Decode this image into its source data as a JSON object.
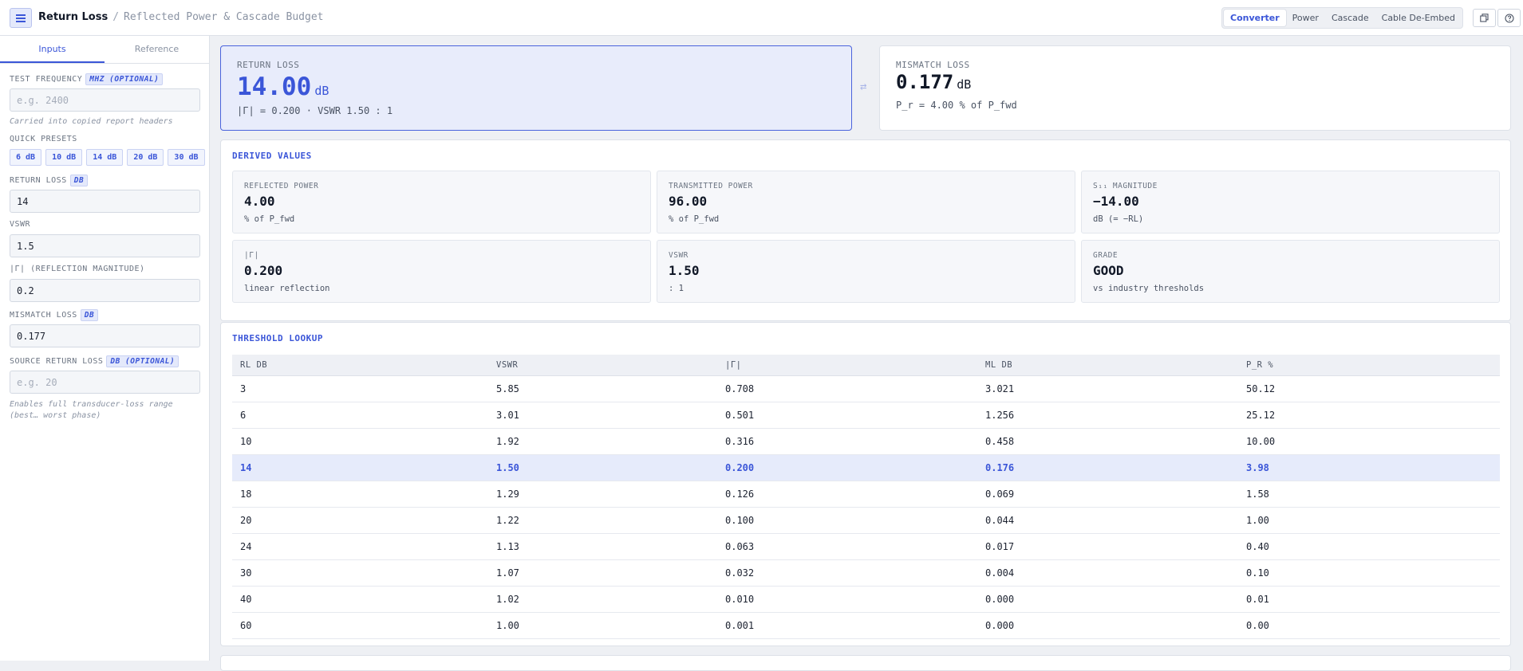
{
  "header": {
    "title": "Return Loss",
    "separator": "/",
    "subtitle": "Reflected Power & Cascade Budget",
    "modes": [
      "Converter",
      "Power",
      "Cascade",
      "Cable De-Embed"
    ],
    "active_mode": "Converter"
  },
  "sidebar": {
    "tabs": [
      "Inputs",
      "Reference"
    ],
    "active_tab": "Inputs",
    "test_frequency": {
      "label": "TEST FREQUENCY",
      "unit": "MHZ (OPTIONAL)",
      "value": "",
      "placeholder": "e.g. 2400",
      "hint": "Carried into copied report headers"
    },
    "quick_presets": {
      "label": "QUICK PRESETS",
      "items": [
        "6 dB",
        "10 dB",
        "14 dB",
        "20 dB",
        "30 dB"
      ]
    },
    "return_loss": {
      "label": "RETURN LOSS",
      "unit": "DB",
      "value": "14"
    },
    "vswr": {
      "label": "VSWR",
      "value": "1.5"
    },
    "gamma": {
      "label": "|Γ| (REFLECTION MAGNITUDE)",
      "value": "0.2"
    },
    "mismatch_loss": {
      "label": "MISMATCH LOSS",
      "unit": "DB",
      "value": "0.177"
    },
    "source_return_loss": {
      "label": "SOURCE RETURN LOSS",
      "unit": "DB (OPTIONAL)",
      "value": "",
      "placeholder": "e.g. 20",
      "hint": "Enables full transducer-loss range (best… worst phase)"
    }
  },
  "result_cards": {
    "return_loss": {
      "label": "RETURN LOSS",
      "value": "14.00",
      "unit": "dB",
      "sub": "|Γ| = 0.200 · VSWR 1.50 : 1"
    },
    "mismatch_loss": {
      "label": "MISMATCH LOSS",
      "value": "0.177",
      "unit": "dB",
      "sub": "P_r = 4.00 % of P_fwd"
    },
    "swap_icon": "⇄"
  },
  "derived": {
    "title": "DERIVED VALUES",
    "items": [
      {
        "label": "REFLECTED POWER",
        "value": "4.00",
        "sub": "% of P_fwd"
      },
      {
        "label": "TRANSMITTED POWER",
        "value": "96.00",
        "sub": "% of P_fwd"
      },
      {
        "label": "S₁₁ MAGNITUDE",
        "value": "−14.00",
        "sub": "dB (= −RL)"
      },
      {
        "label": "|Γ|",
        "value": "0.200",
        "sub": "linear reflection"
      },
      {
        "label": "VSWR",
        "value": "1.50",
        "sub": ": 1"
      },
      {
        "label": "GRADE",
        "value": "GOOD",
        "sub": "vs industry thresholds"
      }
    ]
  },
  "thresholds": {
    "title": "THRESHOLD LOOKUP",
    "columns": [
      "RL DB",
      "VSWR",
      "|Γ|",
      "ML DB",
      "P_R %"
    ],
    "highlight_index": 3,
    "rows": [
      [
        "3",
        "5.85",
        "0.708",
        "3.021",
        "50.12"
      ],
      [
        "6",
        "3.01",
        "0.501",
        "1.256",
        "25.12"
      ],
      [
        "10",
        "1.92",
        "0.316",
        "0.458",
        "10.00"
      ],
      [
        "14",
        "1.50",
        "0.200",
        "0.176",
        "3.98"
      ],
      [
        "18",
        "1.29",
        "0.126",
        "0.069",
        "1.58"
      ],
      [
        "20",
        "1.22",
        "0.100",
        "0.044",
        "1.00"
      ],
      [
        "24",
        "1.13",
        "0.063",
        "0.017",
        "0.40"
      ],
      [
        "30",
        "1.07",
        "0.032",
        "0.004",
        "0.10"
      ],
      [
        "40",
        "1.02",
        "0.010",
        "0.000",
        "0.01"
      ],
      [
        "60",
        "1.00",
        "0.001",
        "0.000",
        "0.00"
      ]
    ]
  },
  "colors": {
    "accent": "#3b56d8",
    "highlight_row": "#e6ebfb",
    "card_active": "#e8ecfb"
  }
}
